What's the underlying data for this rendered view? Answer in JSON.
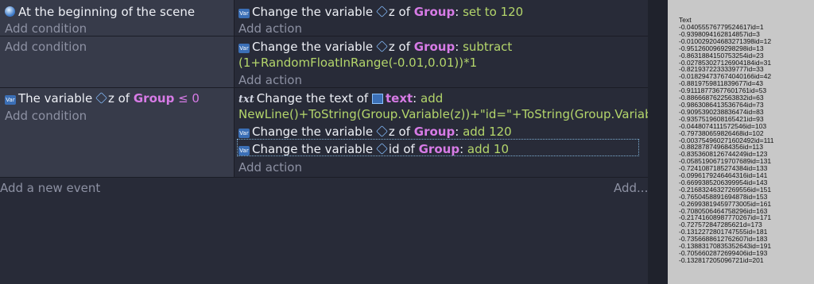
{
  "events": [
    {
      "condition": {
        "text": "At the beginning of the scene",
        "add": "Add condition"
      },
      "action1": {
        "pre": "Change the variable",
        "var": "z",
        "of": "of",
        "obj": "Group",
        "colon": ":",
        "op": "set to 120"
      },
      "add_action": "Add action"
    },
    {
      "condition": {
        "add": "Add condition"
      },
      "action1": {
        "pre": "Change the variable",
        "var": "z",
        "of": "of",
        "obj": "Group",
        "colon": ":",
        "op": "subtract",
        "expr": "(1+RandomFloatInRange(-0.01,0.01))*1"
      },
      "add_action": "Add action"
    },
    {
      "condition": {
        "pre": "The variable",
        "var": "z",
        "of": "of",
        "obj": "Group",
        "op": "≤ 0",
        "add": "Add condition"
      },
      "action1": {
        "pre": "Change the text of",
        "obj": "text",
        "colon": ":",
        "op": "add",
        "expr": "NewLine()+ToString(Group.Variable(z))+\"id=\"+ToString(Group.Variable(id))"
      },
      "action2": {
        "pre": "Change the variable",
        "var": "z",
        "of": "of",
        "obj": "Group",
        "colon": ":",
        "op": "add 120"
      },
      "action3": {
        "pre": "Change the variable",
        "var": "id",
        "of": "of",
        "obj": "Group",
        "colon": ":",
        "op": "add 10"
      },
      "add_action": "Add action"
    }
  ],
  "footer": {
    "add_event": "Add a new event",
    "add_more": "Add..."
  },
  "icons": {
    "var_icon_label": "Var",
    "text_icon_label": "txt"
  },
  "colors": {
    "keyword": "#d77be6",
    "value": "#b4d66b",
    "editor_bg": "#282b38",
    "condition_bg": "#373b4a"
  },
  "preview": {
    "title": "Text",
    "lines": [
      "-0.0405557677952461​7id=1",
      "-0.939809416281485​7id=3",
      "-0.010029204683271398id=12",
      "-0.951260096929829​8id=13",
      "-0.863188415075325​4id=23",
      "-0.0278530271269041​84id=31",
      "-0.821937223333977​7id=33",
      "-0.018294737674040​166id=42",
      "-0.881975981183967​7id=43",
      "-0.911187736776017​61id=53",
      "-0.886668762256383​2id=63",
      "-0.986308641353676​4id=73",
      "-0.909539023883647​4id=83",
      "-0.935751960816542​1id=93",
      "-0.044807411157254​6id=103",
      "-0.797380659826468​id=102",
      "-0.003754960271602492id=111",
      "-0.882878749684356​id=113",
      "-0.835360812674424​9id=123",
      "-0.058519067197076​89id=131",
      "-0.724108718527438​4id=133",
      "-0.099617924646431​6id=141",
      "-0.669938520639995​4id=143",
      "-0.216832463272695​56id=151",
      "-0.765045889169487​8id=153",
      "-0.269938194597730​05id=161",
      "-0.708050646475829​6id=163",
      "-0.217416089877702​67id=171",
      "-0.727572847285621​d=173",
      "-0.131227280174755​5id=181",
      "-0.735668861276260​7id=183",
      "-0.138831708353526​43id=191",
      "-0.705660287269940​6id=193",
      "-0.132817205096721​id=201"
    ]
  }
}
